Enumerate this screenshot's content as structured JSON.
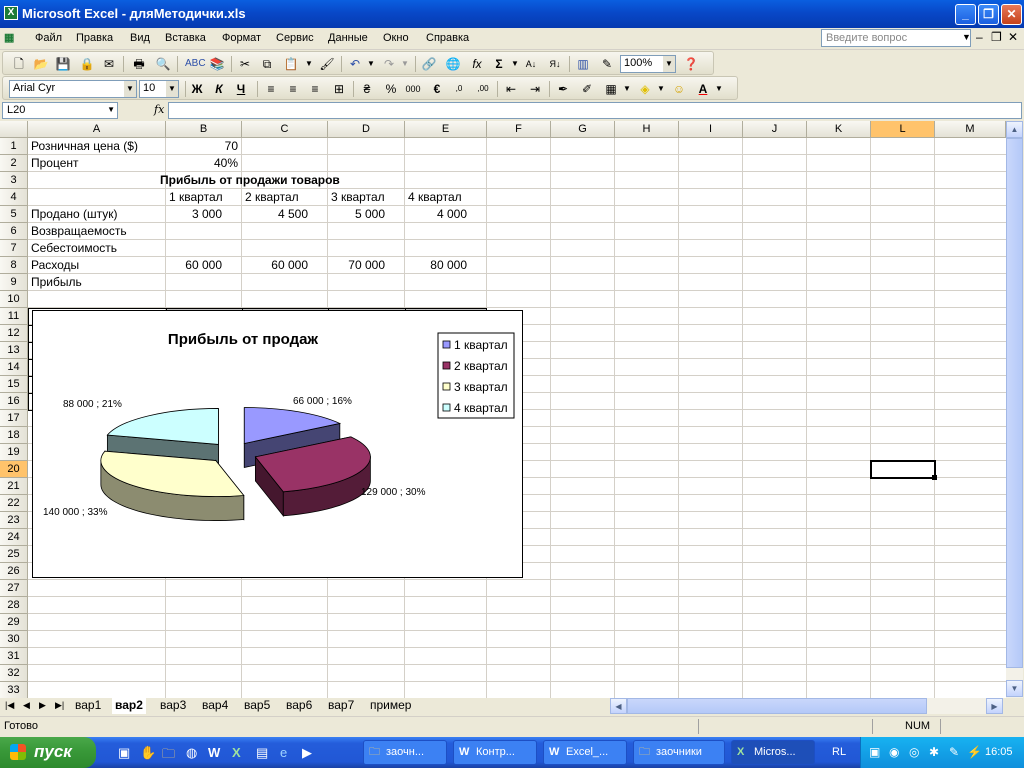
{
  "window": {
    "title": "Microsoft Excel - дляМетодички.xls",
    "app_icon": "excel-icon"
  },
  "menu": {
    "items": [
      "Файл",
      "Правка",
      "Вид",
      "Вставка",
      "Формат",
      "Сервис",
      "Данные",
      "Окно",
      "Справка"
    ],
    "help_placeholder": "Введите вопрос"
  },
  "toolbar": {
    "zoom": "100%",
    "font_name": "Arial Cyr",
    "font_size": "10"
  },
  "formula_bar": {
    "name_box": "L20",
    "fx": "fx",
    "value": ""
  },
  "columns": [
    "A",
    "B",
    "C",
    "D",
    "E",
    "F",
    "G",
    "H",
    "I",
    "J",
    "K",
    "L",
    "M"
  ],
  "selected_cell": {
    "column": "L",
    "row": 20
  },
  "sheet": {
    "retail_label": "Розничная цена ($)",
    "retail_value": "70",
    "percent_label": "Процент",
    "percent_value": "40%",
    "table_title": "Прибыль от продажи товаров",
    "headers": [
      "1 квартал",
      "2 квартал",
      "3 квартал",
      "4 квартал"
    ],
    "row_labels": [
      "Продано (штук)",
      "Возвращаемость",
      "Себестоимость",
      "Расходы",
      "Прибыль"
    ],
    "sold": [
      "3 000",
      "4 500",
      "5 000",
      "4 000"
    ],
    "expenses": [
      "60 000",
      "60 000",
      "70 000",
      "80 000"
    ]
  },
  "chart_data": {
    "type": "pie",
    "title": "Прибыль от продаж",
    "categories": [
      "1 квартал",
      "2 квартал",
      "3 квартал",
      "4 квартал"
    ],
    "values": [
      66000,
      129000,
      140000,
      88000
    ],
    "percents": [
      16,
      30,
      33,
      21
    ],
    "labels": [
      "66 000   ; 16%",
      "129 000   ; 30%",
      "140 000   ; 33%",
      "88 000   ; 21%"
    ],
    "colors": [
      "#9999ff",
      "#993366",
      "#ffffcc",
      "#ccffff"
    ],
    "legend": "right",
    "exploded": true,
    "three_d": true
  },
  "tabs": {
    "items": [
      "вар1",
      "вар2",
      "вар3",
      "вар4",
      "вар5",
      "вар6",
      "вар7",
      "пример"
    ],
    "active": "вар2"
  },
  "status": {
    "ready": "Готово",
    "num": "NUM"
  },
  "taskbar": {
    "start": "пуск",
    "buttons": [
      "заочн...",
      "Контр...",
      "Excel_...",
      "заочники",
      "Micros..."
    ],
    "lang": "RL",
    "clock": "16:05"
  }
}
